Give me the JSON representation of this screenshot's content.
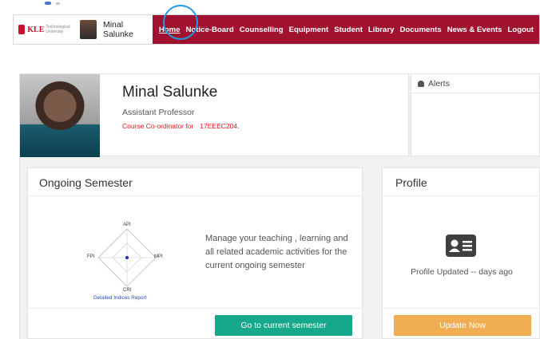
{
  "navbar": {
    "logo_text": "KLE",
    "logo_sub": "Technological University",
    "user_name": "Minal Salunke",
    "menu": [
      "Home",
      "Notice-Board",
      "Counselling",
      "Equipment",
      "Student",
      "Library",
      "Documents",
      "News & Events",
      "Logout"
    ]
  },
  "profile_header": {
    "name": "Minal Salunke",
    "designation": "Assistant Professor",
    "course_label": "Course Co-ordinator for",
    "course_code": "17EEEC204."
  },
  "alerts": {
    "title": "Alerts"
  },
  "ongoing": {
    "title": "Ongoing Semester",
    "radar_labels": {
      "top": "API",
      "left": "FPI",
      "right": "MPI",
      "bottom": "CRI"
    },
    "report_link": "Detailed Indices Report",
    "description": "Manage your teaching , learning and all related academic activities for the current ongoing semester",
    "button": "Go to current semester"
  },
  "profile_card": {
    "title": "Profile",
    "updated_text": "Profile Updated -- days ago",
    "button": "Update Now"
  },
  "colors": {
    "navbar": "#a0122f",
    "go_button": "#16a88a",
    "update_button": "#f1ad52",
    "course": "#e8161c",
    "link": "#2948b5"
  }
}
